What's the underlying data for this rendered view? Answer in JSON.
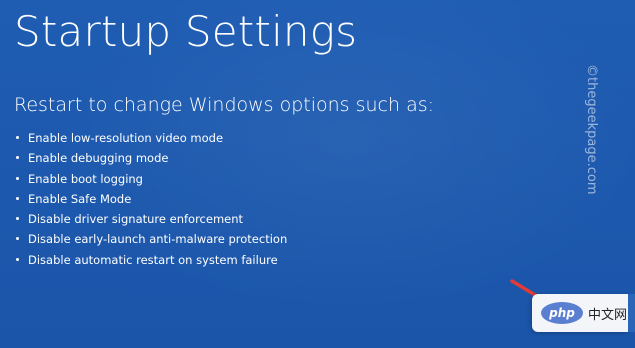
{
  "screen": {
    "title": "Startup Settings",
    "subtitle": "Restart to change Windows options such as:",
    "options": [
      "Enable low-resolution video mode",
      "Enable debugging mode",
      "Enable boot logging",
      "Enable Safe Mode",
      "Disable driver signature enforcement",
      "Disable early-launch anti-malware protection",
      "Disable automatic restart on system failure"
    ]
  },
  "watermark": "©thegeekpage.com",
  "badge": {
    "logo_text": "php",
    "label": "中文网"
  },
  "colors": {
    "background": "#1e5bb0",
    "arrow": "#e23a35"
  },
  "icons": [
    "red-arrow-icon",
    "php-logo-icon"
  ]
}
